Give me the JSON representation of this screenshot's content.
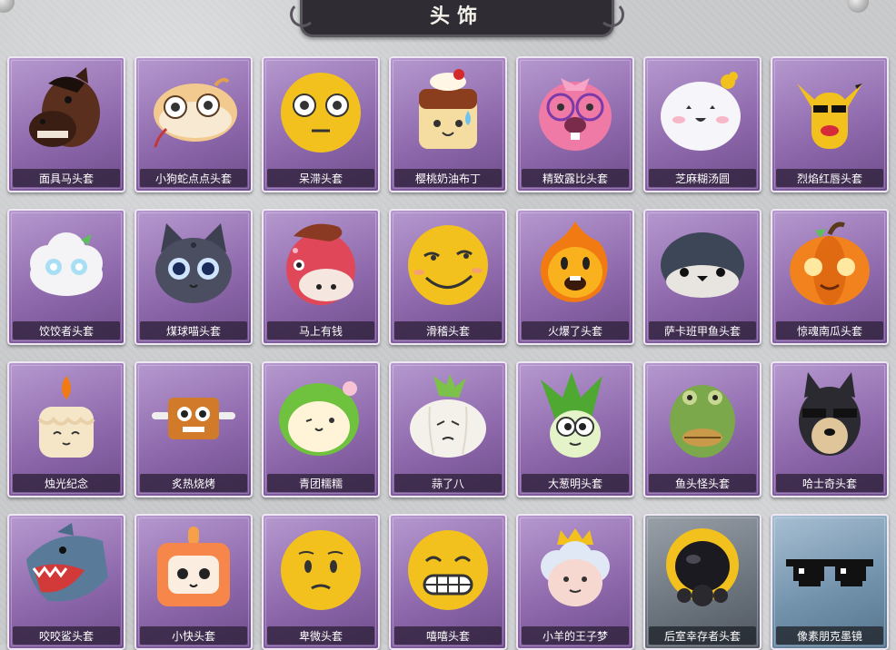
{
  "header": {
    "title": "头饰"
  },
  "items": [
    {
      "label": "面具马头套",
      "icon": "horse-mask-icon"
    },
    {
      "label": "小狗蛇点点头套",
      "icon": "snake-head-icon"
    },
    {
      "label": "呆滞头套",
      "icon": "dazed-face-icon"
    },
    {
      "label": "樱桃奶油布丁",
      "icon": "cherry-pudding-icon"
    },
    {
      "label": "精致露比头套",
      "icon": "pink-beaver-icon"
    },
    {
      "label": "芝麻糊汤圆",
      "icon": "rice-ball-icon"
    },
    {
      "label": "烈焰红唇头套",
      "icon": "yellow-mouse-icon"
    },
    {
      "label": "饺饺者头套",
      "icon": "dumpling-cloud-icon"
    },
    {
      "label": "煤球喵头套",
      "icon": "black-cat-icon"
    },
    {
      "label": "马上有钱",
      "icon": "red-horse-icon"
    },
    {
      "label": "滑稽头套",
      "icon": "funny-face-icon"
    },
    {
      "label": "火爆了头套",
      "icon": "fire-face-icon"
    },
    {
      "label": "萨卡班甲鱼头套",
      "icon": "fish-head-icon"
    },
    {
      "label": "惊魂南瓜头套",
      "icon": "pumpkin-icon"
    },
    {
      "label": "烛光纪念",
      "icon": "candle-icon"
    },
    {
      "label": "炙热烧烤",
      "icon": "bbq-block-icon"
    },
    {
      "label": "青团糯糯",
      "icon": "green-rice-ball-icon"
    },
    {
      "label": "蒜了八",
      "icon": "garlic-icon"
    },
    {
      "label": "大葱明头套",
      "icon": "scallion-icon"
    },
    {
      "label": "鱼头怪头套",
      "icon": "fish-monster-icon"
    },
    {
      "label": "哈士奇头套",
      "icon": "husky-icon"
    },
    {
      "label": "咬咬鲨头套",
      "icon": "shark-icon"
    },
    {
      "label": "小快头套",
      "icon": "tv-robot-icon"
    },
    {
      "label": "卑微头套",
      "icon": "humble-face-icon"
    },
    {
      "label": "嘻嘻头套",
      "icon": "grin-face-icon"
    },
    {
      "label": "小羊的王子梦",
      "icon": "sheep-prince-icon"
    },
    {
      "label": "后室幸存者头套",
      "icon": "gas-mask-helmet-icon"
    },
    {
      "label": "像素朋克墨镜",
      "icon": "pixel-sunglasses-icon"
    }
  ]
}
